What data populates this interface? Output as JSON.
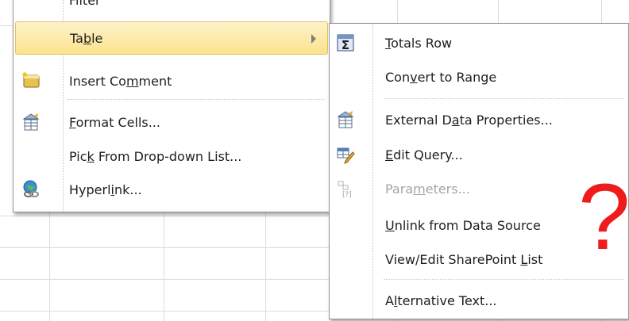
{
  "left_menu": {
    "top_partial_label": "Filter",
    "items": [
      {
        "name": "menu-item-table",
        "label": "Table",
        "icon": "none",
        "has_submenu": true,
        "highlighted": true
      },
      {
        "name": "menu-item-insert-comment",
        "label": "Insert Comment",
        "icon": "comment-icon"
      },
      {
        "name": "menu-item-format-cells",
        "label": "Format Cells...",
        "icon": "format-cells-icon"
      },
      {
        "name": "menu-item-pick-from-list",
        "label": "Pick From Drop-down List...",
        "icon": "none"
      },
      {
        "name": "menu-item-hyperlink",
        "label": "Hyperlink...",
        "icon": "hyperlink-icon"
      }
    ]
  },
  "submenu": {
    "items": [
      {
        "name": "submenu-item-totals-row",
        "label": "Totals Row",
        "icon": "sigma-icon"
      },
      {
        "name": "submenu-item-convert-to-range",
        "label": "Convert to Range",
        "icon": "none"
      },
      {
        "name": "submenu-item-external-data-properties",
        "label": "External Data Properties...",
        "icon": "data-properties-icon"
      },
      {
        "name": "submenu-item-edit-query",
        "label": "Edit Query...",
        "icon": "edit-query-icon"
      },
      {
        "name": "submenu-item-parameters",
        "label": "Parameters...",
        "icon": "parameters-icon",
        "disabled": true
      },
      {
        "name": "submenu-item-unlink",
        "label": "Unlink from Data Source",
        "icon": "none"
      },
      {
        "name": "submenu-item-view-edit-sharepoint",
        "label": "View/Edit SharePoint List",
        "icon": "none"
      },
      {
        "name": "submenu-item-alt-text",
        "label": "Alternative Text...",
        "icon": "none"
      }
    ]
  },
  "annotation": {
    "text": "?",
    "color": "#ee1c1c"
  },
  "colors": {
    "highlight_top": "#fdf3c9",
    "highlight_bottom": "#fbe28f",
    "disabled_text": "#a4a4a4"
  }
}
